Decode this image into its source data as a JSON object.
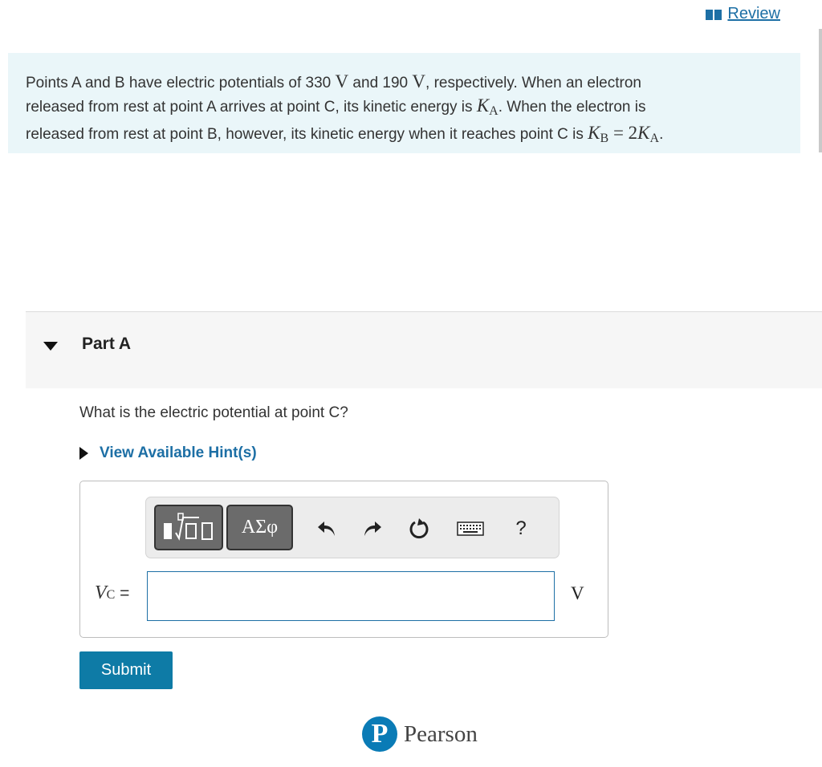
{
  "header": {
    "review_label": "Review"
  },
  "problem": {
    "s1": "Points A and B have electric potentials of 330 ",
    "unit_v": "V",
    "s2": " and 190 ",
    "s3": ", respectively. When an electron",
    "s4": "released from rest at point A arrives at point C, its kinetic energy is ",
    "K": "K",
    "subA": "A",
    "s5": ". When the electron is",
    "s6": "released from rest at point B, however, its kinetic energy when it reaches point C is ",
    "subB": "B",
    "eq": " = 2",
    "s7": "."
  },
  "part": {
    "title": "Part A"
  },
  "question": "What is the electric potential at point C?",
  "hints_label": "View Available Hint(s)",
  "toolbar": {
    "greek_label": "ΑΣφ",
    "help_label": "?",
    "icons": [
      "templates-icon",
      "undo-icon",
      "redo-icon",
      "reset-icon",
      "keyboard-icon",
      "help-icon"
    ]
  },
  "answer": {
    "var": "V",
    "var_sub": "C",
    "equals": " =",
    "value": "",
    "unit": "V"
  },
  "submit_label": "Submit",
  "footer": {
    "logo_letter": "P",
    "brand": "Pearson"
  },
  "colors": {
    "accent": "#1d6fa5",
    "problem_bg": "#eaf6f9",
    "submit_bg": "#0e7ba6",
    "logo": "#0a7bb6"
  }
}
